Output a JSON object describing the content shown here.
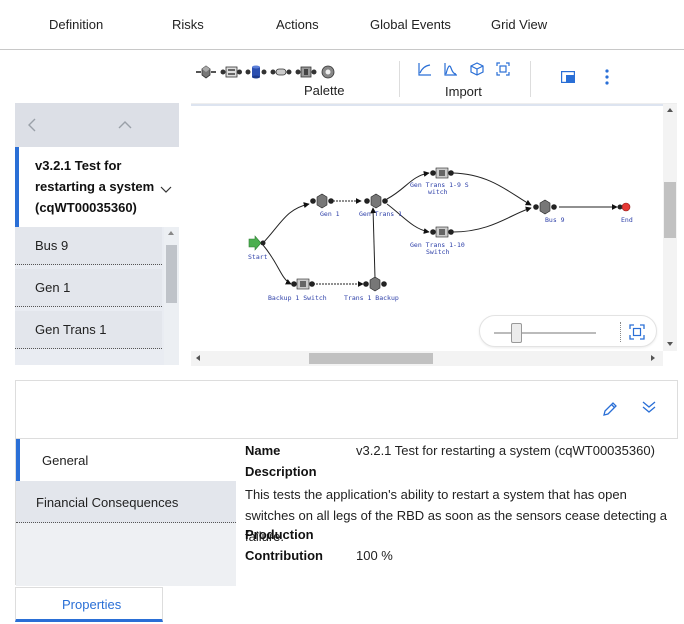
{
  "top_tabs": [
    "Definition",
    "Risks",
    "Actions",
    "Global Events",
    "Grid View"
  ],
  "toolbar": {
    "palette_label": "Palette",
    "import_label": "Import",
    "palette_icons": [
      "cube-block-icon",
      "switch-block-icon",
      "cylinder-block-icon",
      "link-block-icon",
      "sensor-block-icon",
      "gear-block-icon"
    ],
    "import_icons": [
      "line-chart-icon",
      "distribution-icon",
      "box-icon",
      "fit-frame-icon"
    ]
  },
  "left_panel": {
    "selected_title": "v3.2.1 Test for restarting a system (cqWT00035360)",
    "items": [
      "Bus 9",
      "Gen 1",
      "Gen Trans 1"
    ]
  },
  "diagram": {
    "nodes": [
      "Start",
      "Gen 1",
      "Gen Trans 1",
      "Gen Trans 1-9 S witch",
      "Gen Trans 1-10 Switch",
      "Bus 9",
      "End",
      "Backup 1 Switch",
      "Trans 1 Backup"
    ]
  },
  "properties": {
    "side_tabs": [
      "General",
      "Financial Consequences"
    ],
    "fields": {
      "name_label": "Name",
      "name_value": "v3.2.1 Test for restarting a system (cqWT00035360)",
      "description_label": "Description",
      "description_value": "This tests the application's ability to restart a system that has open switches on all legs of the RBD as soon as the sensors cease detecting a failure.",
      "production_label": "Production",
      "contribution_label": "Contribution",
      "contribution_value": "100 %"
    },
    "bottom_tab": "Properties"
  },
  "colors": {
    "accent": "#2a6fd6",
    "diagram_label": "#2d3fa8",
    "start_node": "#4caf50",
    "end_node": "#e53935"
  }
}
